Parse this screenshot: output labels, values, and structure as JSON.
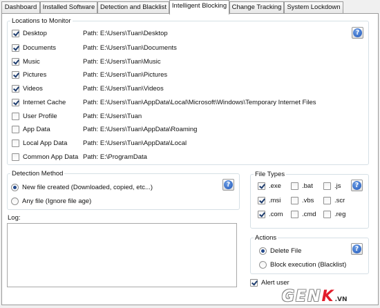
{
  "tabs": [
    "Dashboard",
    "Installed Software",
    "Detection and Blacklist",
    "Intelligent Blocking",
    "Change Tracking",
    "System Lockdown"
  ],
  "active_tab": "Intelligent Blocking",
  "locations": {
    "title": "Locations to Monitor",
    "items": [
      {
        "label": "Desktop",
        "path": "Path: E:\\Users\\Tuan\\Desktop",
        "checked": true
      },
      {
        "label": "Documents",
        "path": "Path: E:\\Users\\Tuan\\Documents",
        "checked": true
      },
      {
        "label": "Music",
        "path": "Path: E:\\Users\\Tuan\\Music",
        "checked": true
      },
      {
        "label": "Pictures",
        "path": "Path: E:\\Users\\Tuan\\Pictures",
        "checked": true
      },
      {
        "label": "Videos",
        "path": "Path: E:\\Users\\Tuan\\Videos",
        "checked": true
      },
      {
        "label": "Internet Cache",
        "path": "Path: E:\\Users\\Tuan\\AppData\\Local\\Microsoft\\Windows\\Temporary Internet Files",
        "checked": true
      },
      {
        "label": "User Profile",
        "path": "Path: E:\\Users\\Tuan",
        "checked": false
      },
      {
        "label": "App Data",
        "path": "Path: E:\\Users\\Tuan\\AppData\\Roaming",
        "checked": false
      },
      {
        "label": "Local App Data",
        "path": "Path: E:\\Users\\Tuan\\AppData\\Local",
        "checked": false
      },
      {
        "label": "Common App Data",
        "path": "Path: E:\\ProgramData",
        "checked": false
      }
    ]
  },
  "detection": {
    "title": "Detection Method",
    "options": [
      {
        "label": "New file created (Downloaded, copied, etc...)",
        "selected": true
      },
      {
        "label": "Any file (Ignore file age)",
        "selected": false
      }
    ]
  },
  "file_types": {
    "title": "File Types",
    "items": [
      {
        "label": ".exe",
        "checked": true
      },
      {
        "label": ".bat",
        "checked": false
      },
      {
        "label": ".js",
        "checked": false
      },
      {
        "label": ".msi",
        "checked": true
      },
      {
        "label": ".vbs",
        "checked": false
      },
      {
        "label": ".scr",
        "checked": false
      },
      {
        "label": ".com",
        "checked": true
      },
      {
        "label": ".cmd",
        "checked": false
      },
      {
        "label": ".reg",
        "checked": false
      }
    ]
  },
  "log": {
    "label": "Log:",
    "text": ""
  },
  "actions": {
    "title": "Actions",
    "options": [
      {
        "label": "Delete File",
        "selected": true
      },
      {
        "label": "Block execution (Blacklist)",
        "selected": false
      }
    ]
  },
  "alert": {
    "label": "Alert user",
    "checked": true
  },
  "help_glyph": "?",
  "watermark": {
    "gen": "GEN",
    "k": "K",
    "vn": ".VN"
  }
}
